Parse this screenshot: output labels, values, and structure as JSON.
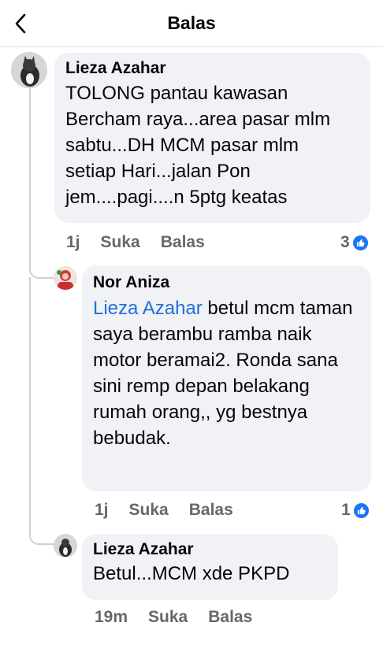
{
  "header": {
    "title": "Balas"
  },
  "comments": [
    {
      "author": "Lieza Azahar",
      "text": "TOLONG pantau kawasan Bercham raya...area pasar mlm sabtu...DH MCM pasar mlm setiap Hari...jalan Pon jem....pagi....n 5ptg keatas",
      "time": "1j",
      "like_label": "Suka",
      "reply_label": "Balas",
      "reactions": "3"
    },
    {
      "author": "Nor Aniza",
      "mention": "Lieza Azahar",
      "text": " betul mcm taman saya berambu ramba naik motor beramai2. Ronda sana sini remp depan belakang rumah orang,, yg bestnya bebudak.",
      "time": "1j",
      "like_label": "Suka",
      "reply_label": "Balas",
      "reactions": "1"
    },
    {
      "author": "Lieza Azahar",
      "text": "Betul...MCM xde PKPD",
      "time": "19m",
      "like_label": "Suka",
      "reply_label": "Balas"
    }
  ],
  "colors": {
    "mention": "#216fdb",
    "like": "#1877f2",
    "bubble": "#f0f2f5"
  }
}
